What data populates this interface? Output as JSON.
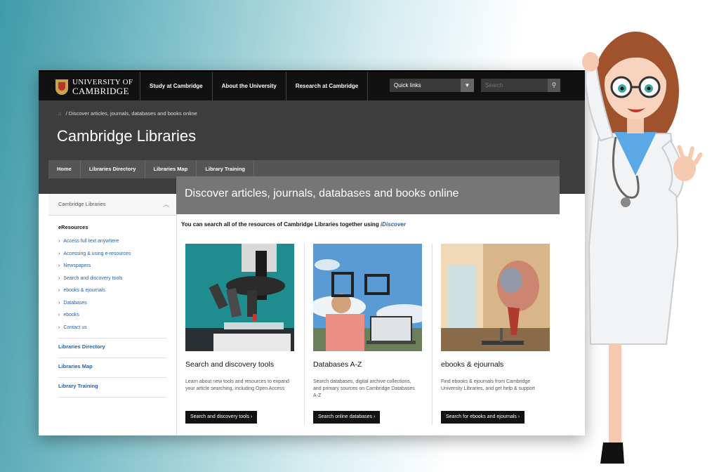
{
  "topbar": {
    "logo_line1": "UNIVERSITY OF",
    "logo_line2": "CAMBRIDGE",
    "nav": [
      "Study at Cambridge",
      "About the University",
      "Research at Cambridge"
    ],
    "quick_links_label": "Quick links",
    "search_placeholder": "Search"
  },
  "header": {
    "breadcrumb": "Discover articles, journals, databases and books online",
    "title": "Cambridge Libraries",
    "secondary_nav": [
      "Home",
      "Libraries Directory",
      "Libraries Map",
      "Library Training"
    ]
  },
  "sidebar": {
    "heading": "Cambridge Libraries",
    "group_title": "eResources",
    "links": [
      "Access full text anywhere",
      "Accessing & using e-resources",
      "Newspapers",
      "Search and discovery tools",
      "ebooks & ejournals",
      "Databases",
      "ebooks",
      "Contact us"
    ],
    "main_links": [
      "Libraries Directory",
      "Libraries Map",
      "Library Training"
    ]
  },
  "main": {
    "banner": "Discover articles, journals, databases and books online",
    "intro_text": "You can search all of the resources of Cambridge Libraries together using",
    "intro_link": "iDiscover",
    "cards": [
      {
        "title": "Search and discovery tools",
        "description": "Learn about new tools and resources to expand your article searching, including Open Access",
        "button": "Search and discovery tools"
      },
      {
        "title": "Databases A-Z",
        "description": "Search databases, digital archive collections, and primary sources on Cambridge Databases A-Z",
        "button": "Search online databases"
      },
      {
        "title": "ebooks & ejournals",
        "description": "Find ebooks & ejournals from Cambridge University Libraries, and get help & support",
        "button": "Search for ebooks and ejournals"
      }
    ]
  },
  "icons": {
    "home": "home-icon",
    "search": "search-icon",
    "dropdown": "chevron-down-icon",
    "collapse": "chevron-up-icon",
    "link_arrow": "chevron-right-icon"
  },
  "colors": {
    "topbar": "#111111",
    "header": "#3d3d3d",
    "link": "#2462a8",
    "banner": "#767676"
  }
}
